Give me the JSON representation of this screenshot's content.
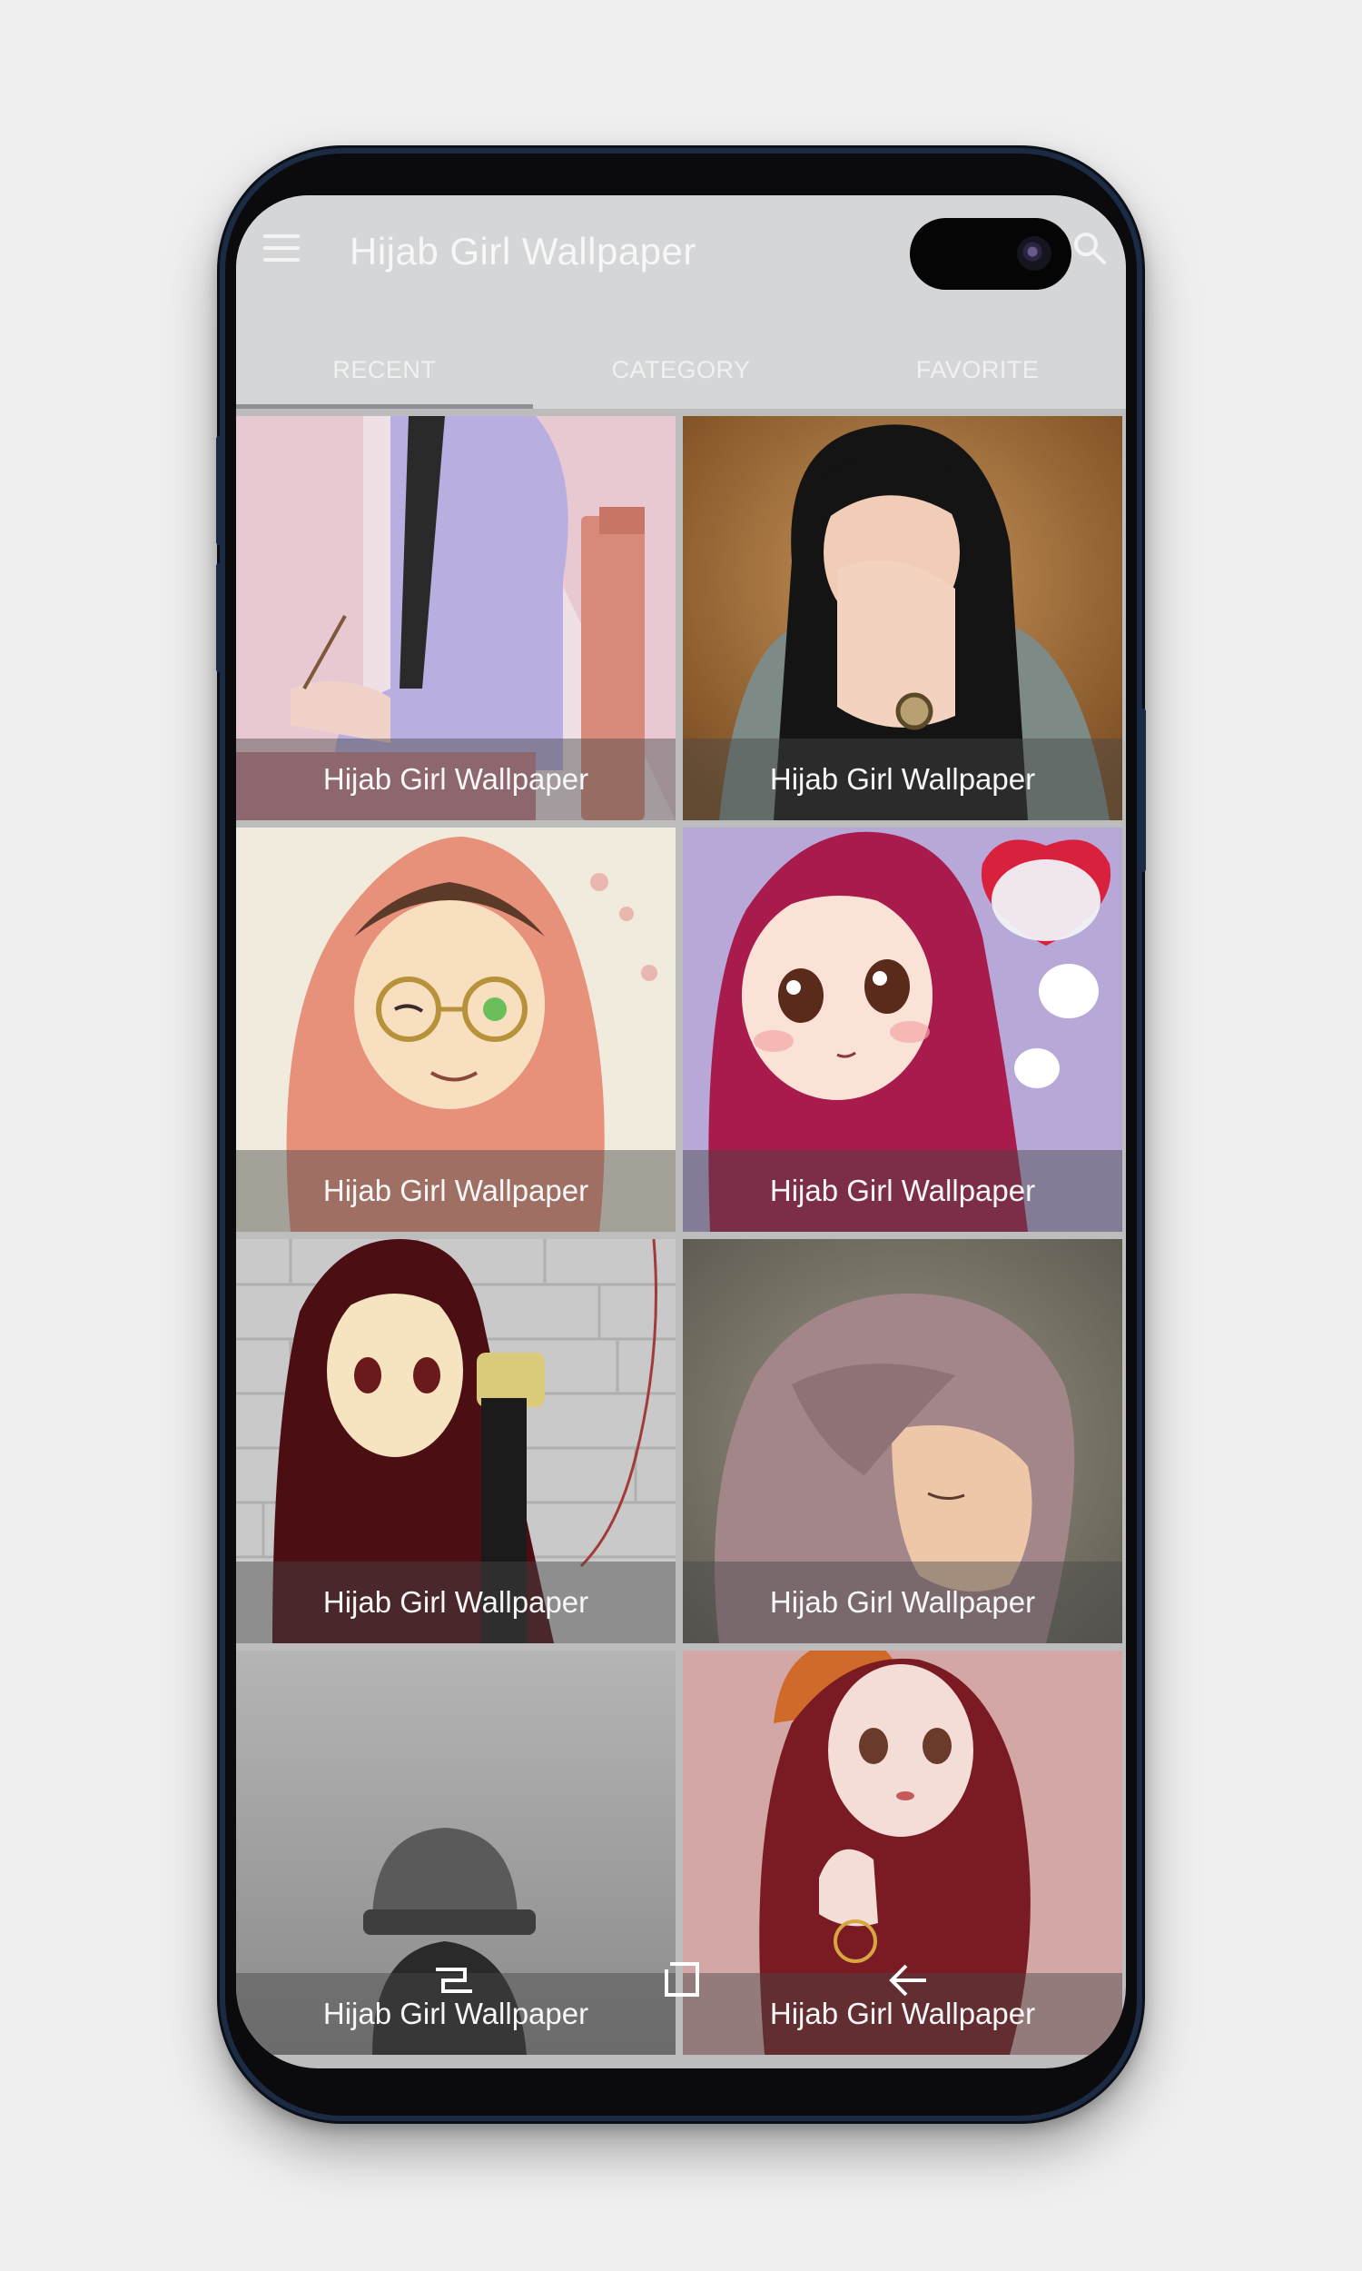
{
  "app": {
    "title": "Hijab Girl Wallpaper"
  },
  "icons": {
    "menu": "hamburger-menu-icon",
    "search": "search-icon"
  },
  "tabs": [
    {
      "label": "RECENT",
      "active": true
    },
    {
      "label": "CATEGORY",
      "active": false
    },
    {
      "label": "FAVORITE",
      "active": false
    }
  ],
  "wallpapers": [
    {
      "caption": "Hijab Girl Wallpaper"
    },
    {
      "caption": "Hijab Girl Wallpaper"
    },
    {
      "caption": "Hijab Girl Wallpaper"
    },
    {
      "caption": "Hijab Girl Wallpaper"
    },
    {
      "caption": "Hijab Girl Wallpaper"
    },
    {
      "caption": "Hijab Girl Wallpaper"
    },
    {
      "caption": "Hijab Girl Wallpaper"
    },
    {
      "caption": "Hijab Girl Wallpaper"
    }
  ],
  "navbar": {
    "recent": "recent-apps-icon",
    "home": "home-icon",
    "back": "back-icon"
  },
  "colors": {
    "appbar": "#d5d6d8",
    "device_frame": "#1c2b44"
  }
}
